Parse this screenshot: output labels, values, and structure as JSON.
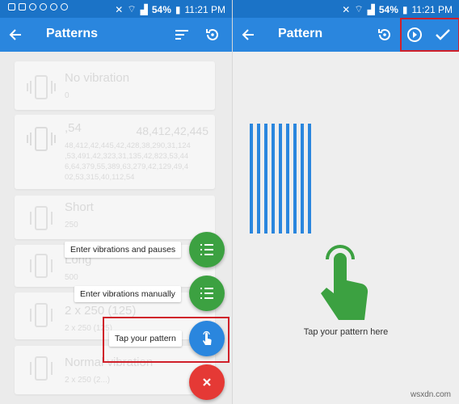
{
  "status_bar": {
    "battery": "54%",
    "time": "11:21 PM"
  },
  "left_screen": {
    "title": "Patterns",
    "patterns": [
      {
        "name": "No vibration",
        "sub": "0",
        "right": ""
      },
      {
        "name": ",54",
        "right": "48,412,42,445",
        "sub_lines": [
          "48,412,42,445,42,428,38,290,31,124",
          ",53,491,42,323,31,135,42,823,53,44",
          "6,64,379,55,389,63,279,42,129,49,4",
          "02,53,315,40,112,54"
        ]
      },
      {
        "name": "Short",
        "sub": "250",
        "right": ""
      },
      {
        "name": "Long",
        "sub": "500",
        "right": ""
      },
      {
        "name": "2 x 250 (125)",
        "sub": "2 x 250 (125)",
        "right": ""
      },
      {
        "name": "Normal vibration",
        "sub": "2 x 250 (2...)",
        "right": ""
      }
    ],
    "fab_menu": {
      "enter_vibrations_pauses": "Enter vibrations and pauses",
      "enter_vibrations_manually": "Enter vibrations manually",
      "tap_your_pattern": "Tap your pattern"
    }
  },
  "right_screen": {
    "title": "Pattern",
    "caption": "Tap your pattern here"
  },
  "watermark": "wsxdn.com",
  "colors": {
    "primary": "#2a86de",
    "status": "#1b73c7",
    "green": "#3ca141",
    "red": "#e53935",
    "highlight": "#d0202a"
  }
}
